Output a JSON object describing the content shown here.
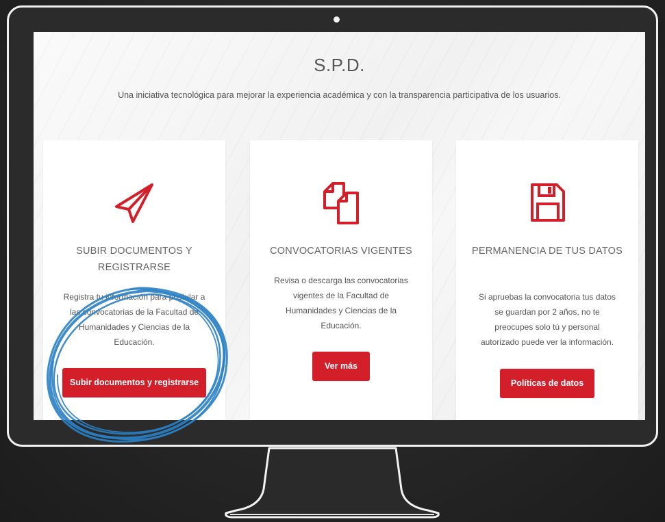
{
  "hero": {
    "title": "S.P.D.",
    "subtitle": "Una iniciativa tecnológica para mejorar la experiencia académica y con la transparencia participativa de los usuarios."
  },
  "cards": [
    {
      "icon": "paper-plane-icon",
      "title": "SUBIR DOCUMENTOS Y REGISTRARSE",
      "text": "Registra tu información para postular a las convocatorias de la Facultad de Humanidades y Ciencias de la Educación.",
      "button": "Subir documentos y registrarse"
    },
    {
      "icon": "documents-icon",
      "title": "CONVOCATORIAS VIGENTES",
      "text": "Revisa o descarga las convocatorias vigentes de la Facultad de Humanidades y Ciencias de la Educación.",
      "button": "Ver más"
    },
    {
      "icon": "floppy-disk-icon",
      "title": "PERMANENCIA DE TUS DATOS",
      "text": "Si apruebas la convocatoria tus datos se guardan por 2 años, no te preocupes solo tú y personal autorizado puede ver la información.",
      "button": "Políticas de datos"
    }
  ],
  "colors": {
    "accent": "#d31f2a",
    "annotation": "#2a7fc4",
    "background": "#262626"
  }
}
